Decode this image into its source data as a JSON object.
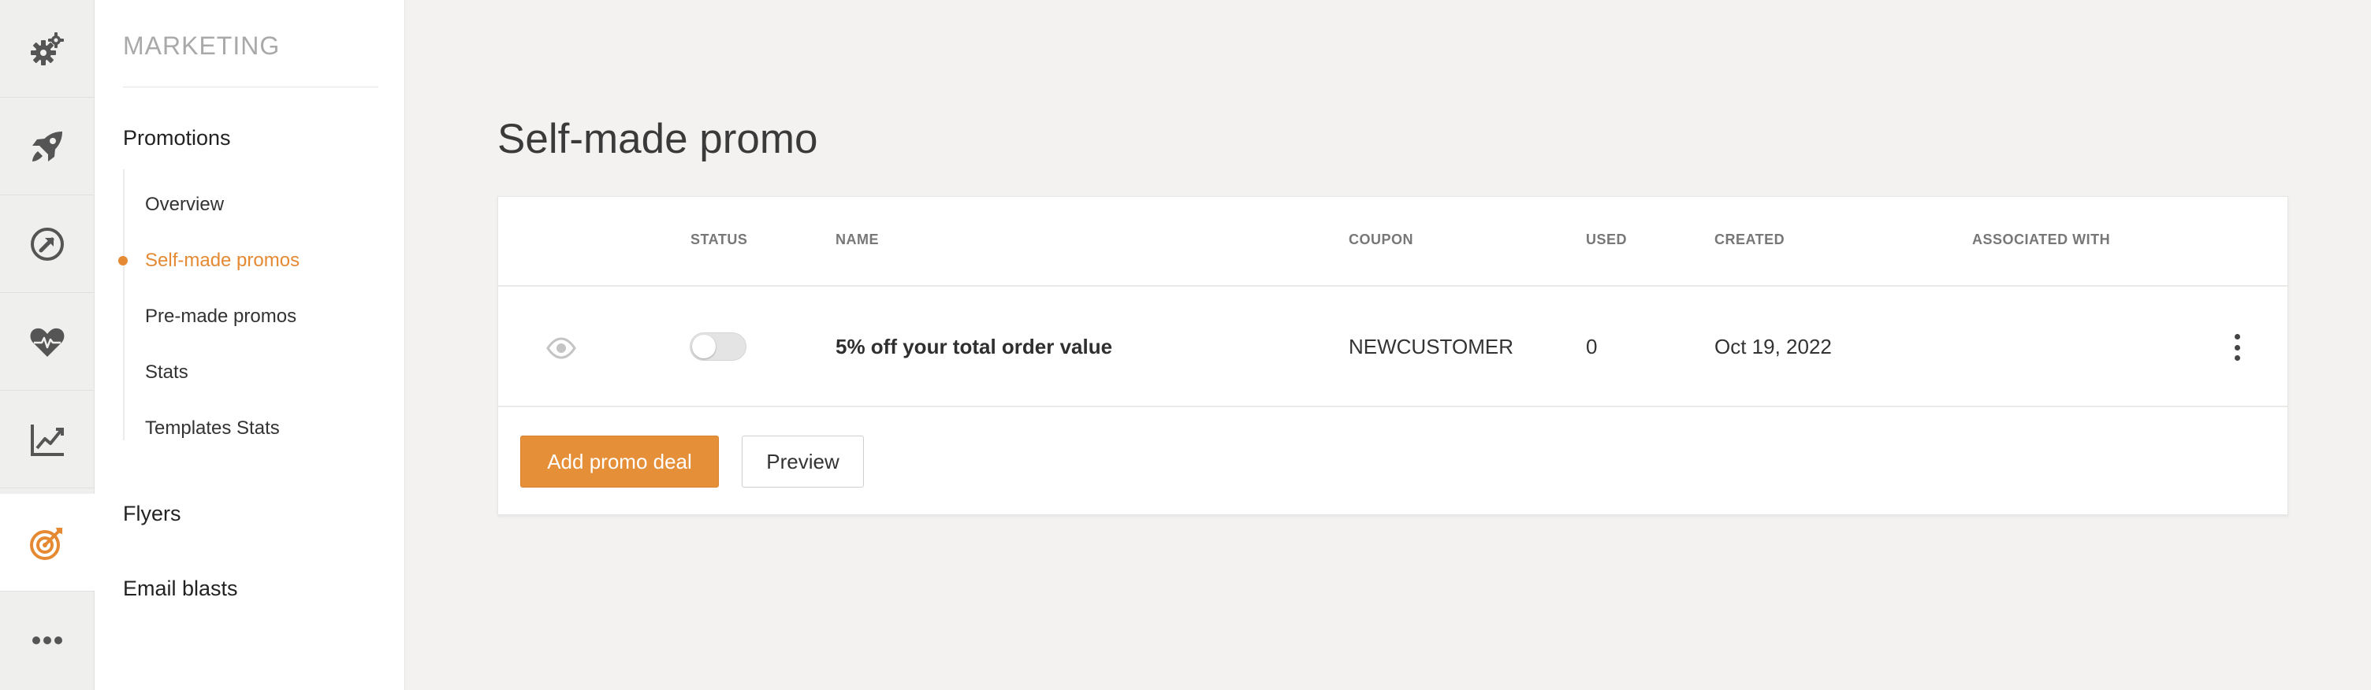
{
  "app": {
    "colors": {
      "accent": "#e58a33",
      "rail_icon": "#555555"
    }
  },
  "rail": {
    "items": [
      {
        "icon": "gears-icon",
        "active": false
      },
      {
        "icon": "rocket-icon",
        "active": false
      },
      {
        "icon": "target-arrow-icon",
        "active": false
      },
      {
        "icon": "heart-pulse-icon",
        "active": false
      },
      {
        "icon": "line-chart-icon",
        "active": false
      },
      {
        "icon": "bullseye-icon",
        "active": true
      },
      {
        "icon": "more-icon",
        "active": false
      }
    ]
  },
  "subnav": {
    "title": "MARKETING",
    "groups": [
      {
        "label": "Promotions",
        "items": [
          {
            "label": "Overview",
            "active": false
          },
          {
            "label": "Self-made promos",
            "active": true
          },
          {
            "label": "Pre-made promos",
            "active": false
          },
          {
            "label": "Stats",
            "active": false
          },
          {
            "label": "Templates Stats",
            "active": false
          }
        ]
      },
      {
        "label": "Flyers"
      },
      {
        "label": "Email blasts"
      }
    ]
  },
  "main": {
    "title": "Self-made promo",
    "table": {
      "columns": [
        "STATUS",
        "NAME",
        "COUPON",
        "USED",
        "CREATED",
        "ASSOCIATED WITH"
      ],
      "rows": [
        {
          "status_on": false,
          "name": "5% off your total order value",
          "coupon": "NEWCUSTOMER",
          "used": "0",
          "created": "Oct 19, 2022",
          "associated_with": ""
        }
      ]
    },
    "buttons": {
      "add_label": "Add promo deal",
      "preview_label": "Preview"
    }
  }
}
